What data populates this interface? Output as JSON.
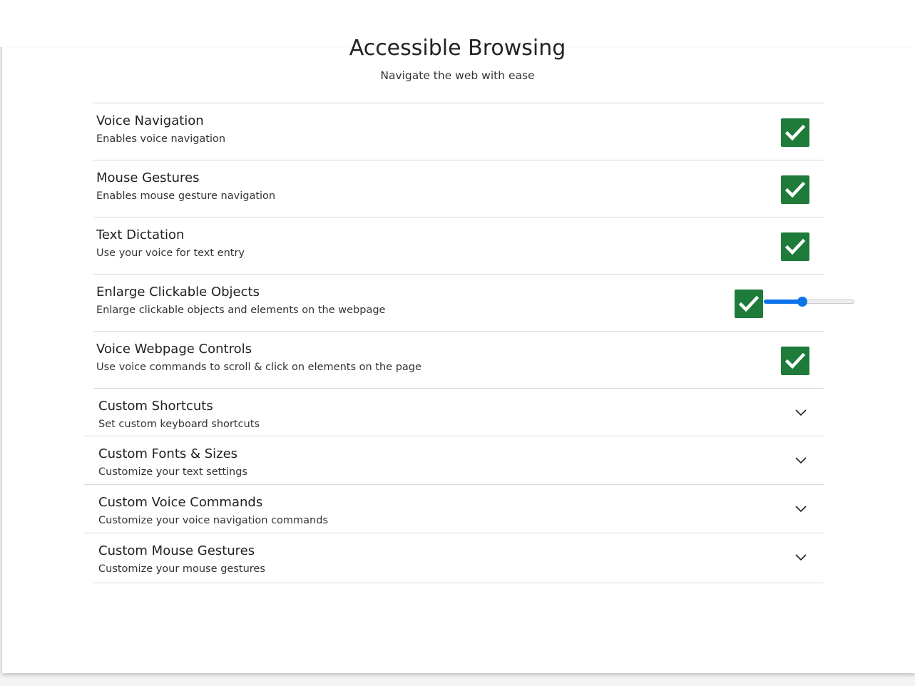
{
  "header": {
    "title": "Accessible Browsing",
    "subtitle": "Navigate the web with ease"
  },
  "settings": [
    {
      "name": "Voice Navigation",
      "description": "Enables voice navigation",
      "checked": true
    },
    {
      "name": "Mouse Gestures",
      "description": "Enables mouse gesture navigation",
      "checked": true
    },
    {
      "name": "Text Dictation",
      "description": "Use your voice for text entry",
      "checked": true
    },
    {
      "name": "Enlarge Clickable Objects",
      "description": "Enlarge clickable objects and elements on the webpage",
      "checked": true,
      "slider_value": 0.42
    },
    {
      "name": "Voice Webpage Controls",
      "description": "Use voice commands to scroll & click on elements on the page",
      "checked": true
    }
  ],
  "sections": [
    {
      "name": "Custom Shortcuts",
      "description": "Set custom keyboard shortcuts"
    },
    {
      "name": "Custom Fonts & Sizes",
      "description": "Customize your text settings"
    },
    {
      "name": "Custom Voice Commands",
      "description": "Customize your voice navigation commands"
    },
    {
      "name": "Custom Mouse Gestures",
      "description": "Customize your mouse gestures"
    }
  ],
  "colors": {
    "checkbox": "#1e7b3a",
    "slider": "#0b73e8"
  },
  "icons": {
    "check": "check-icon",
    "chevron": "chevron-down-icon"
  }
}
